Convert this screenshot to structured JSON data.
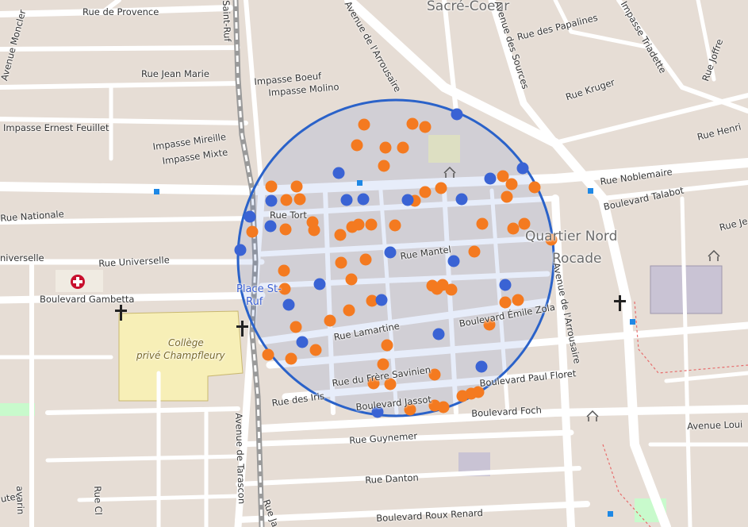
{
  "map": {
    "streets": [
      {
        "id": "rue-de-provence",
        "text": "Rue de Provence"
      },
      {
        "id": "sacre-coeur",
        "text": "Sacré-Coeur"
      },
      {
        "id": "saint-ruf",
        "text": "Saint-Ruf"
      },
      {
        "id": "avenue-arrousaire-north",
        "text": "Avenue de l'Arrousaire"
      },
      {
        "id": "avenue-des-sources",
        "text": "Avenue des Sources"
      },
      {
        "id": "rue-des-papalines",
        "text": "Rue des Papalines"
      },
      {
        "id": "impasse-triadette",
        "text": "Impasse Triadette"
      },
      {
        "id": "rue-joffre",
        "text": "Rue Joffre"
      },
      {
        "id": "avenue-moncler",
        "text": "Avenue Moncler"
      },
      {
        "id": "rue-jean-marie",
        "text": "Rue Jean Marie"
      },
      {
        "id": "impasse-boeuf",
        "text": "Impasse Boeuf"
      },
      {
        "id": "impasse-molino",
        "text": "Impasse Molino"
      },
      {
        "id": "rue-kruger",
        "text": "Rue Kruger"
      },
      {
        "id": "impasse-ernest-feuillet",
        "text": "Impasse Ernest Feuillet"
      },
      {
        "id": "impasse-mireille",
        "text": "Impasse Mireille"
      },
      {
        "id": "impasse-mixte",
        "text": "Impasse Mixte"
      },
      {
        "id": "rue-henri",
        "text": "Rue Henri"
      },
      {
        "id": "rue-noblemaire",
        "text": "Rue Noblemaire"
      },
      {
        "id": "boulevard-talabot",
        "text": "Boulevard Talabot"
      },
      {
        "id": "rue-nationale",
        "text": "Rue Nationale"
      },
      {
        "id": "rue-tort",
        "text": "Rue Tort"
      },
      {
        "id": "rue-je",
        "text": "Rue Je"
      },
      {
        "id": "quartier-nord",
        "text": "Quartier Nord"
      },
      {
        "id": "rocade",
        "text": "Rocade"
      },
      {
        "id": "universelle-left",
        "text": "niverselle"
      },
      {
        "id": "rue-universelle",
        "text": "Rue Universelle"
      },
      {
        "id": "rue-mantel",
        "text": "Rue Mantel"
      },
      {
        "id": "boulevard-gambetta",
        "text": "Boulevard Gambetta"
      },
      {
        "id": "place-st",
        "text": "Place St-"
      },
      {
        "id": "ruf",
        "text": "Ruf"
      },
      {
        "id": "boulevard-emile-zola",
        "text": "Boulevard Émile Zola"
      },
      {
        "id": "avenue-arrousaire-south",
        "text": "Avenue de l'Arrousaire"
      },
      {
        "id": "rue-lamartine",
        "text": "Rue Lamartine"
      },
      {
        "id": "college",
        "text": "Collège"
      },
      {
        "id": "college-name",
        "text": "privé Champfleury"
      },
      {
        "id": "rue-du-frere-savinien",
        "text": "Rue du Frère Savinien"
      },
      {
        "id": "boulevard-paul-floret",
        "text": "Boulevard Paul Floret"
      },
      {
        "id": "rue-des-iris",
        "text": "Rue des Iris"
      },
      {
        "id": "boulevard-jassot",
        "text": "Boulevard Jassot"
      },
      {
        "id": "boulevard-foch",
        "text": "Boulevard Foch"
      },
      {
        "id": "avenue-de-tarascon",
        "text": "Avenue de Tarascon"
      },
      {
        "id": "avenue-louis",
        "text": "Avenue Loui"
      },
      {
        "id": "rue-guynemer",
        "text": "Rue Guynemer"
      },
      {
        "id": "rue-danton",
        "text": "Rue Danton"
      },
      {
        "id": "rue-cl",
        "text": "Rue Cl"
      },
      {
        "id": "utes",
        "text": "utes"
      },
      {
        "id": "avarin",
        "text": "avarin"
      },
      {
        "id": "rue-ja",
        "text": "Rue Ja"
      },
      {
        "id": "boulevard-roux-renard",
        "text": "Boulevard Roux Renard"
      }
    ],
    "colors": {
      "background": "#f2efe9",
      "building": "#d9d0c9",
      "road": "#ffffff",
      "circle": "#2a62c9",
      "orange_marker": "#f47a20",
      "blue_marker": "#3a63d4",
      "school_area": "#f7efb7",
      "park": "#c8facc"
    },
    "circle_center": {
      "lat": null,
      "lon": null
    },
    "markers": {
      "orange_count": 78,
      "blue_count": 26
    }
  }
}
